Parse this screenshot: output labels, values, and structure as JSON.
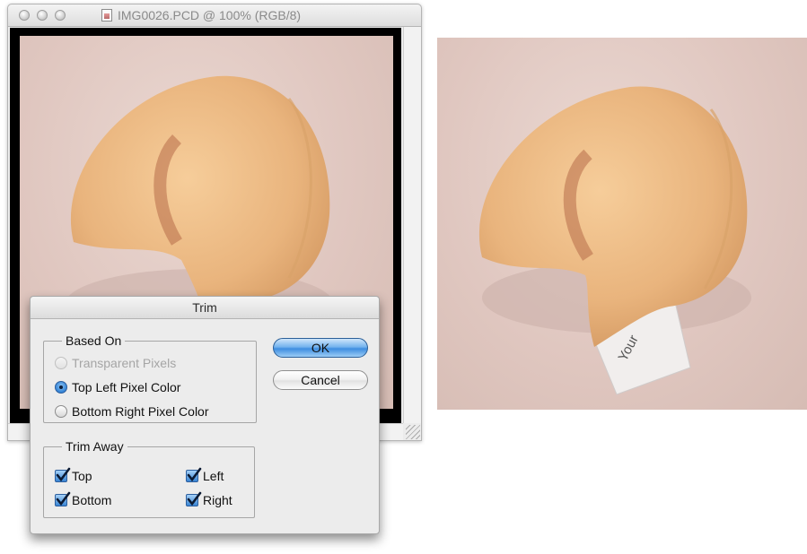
{
  "document_window": {
    "title": "IMG0026.PCD @ 100% (RGB/8)"
  },
  "preview": {
    "slip_text": "Your"
  },
  "dialog": {
    "title": "Trim",
    "based_on": {
      "label": "Based On",
      "options": [
        {
          "label": "Transparent Pixels",
          "selected": false,
          "enabled": false
        },
        {
          "label": "Top Left Pixel Color",
          "selected": true,
          "enabled": true
        },
        {
          "label": "Bottom Right Pixel Color",
          "selected": false,
          "enabled": true
        }
      ]
    },
    "trim_away": {
      "label": "Trim Away",
      "top": "Top",
      "left": "Left",
      "bottom": "Bottom",
      "right": "Right"
    },
    "ok_label": "OK",
    "cancel_label": "Cancel"
  }
}
